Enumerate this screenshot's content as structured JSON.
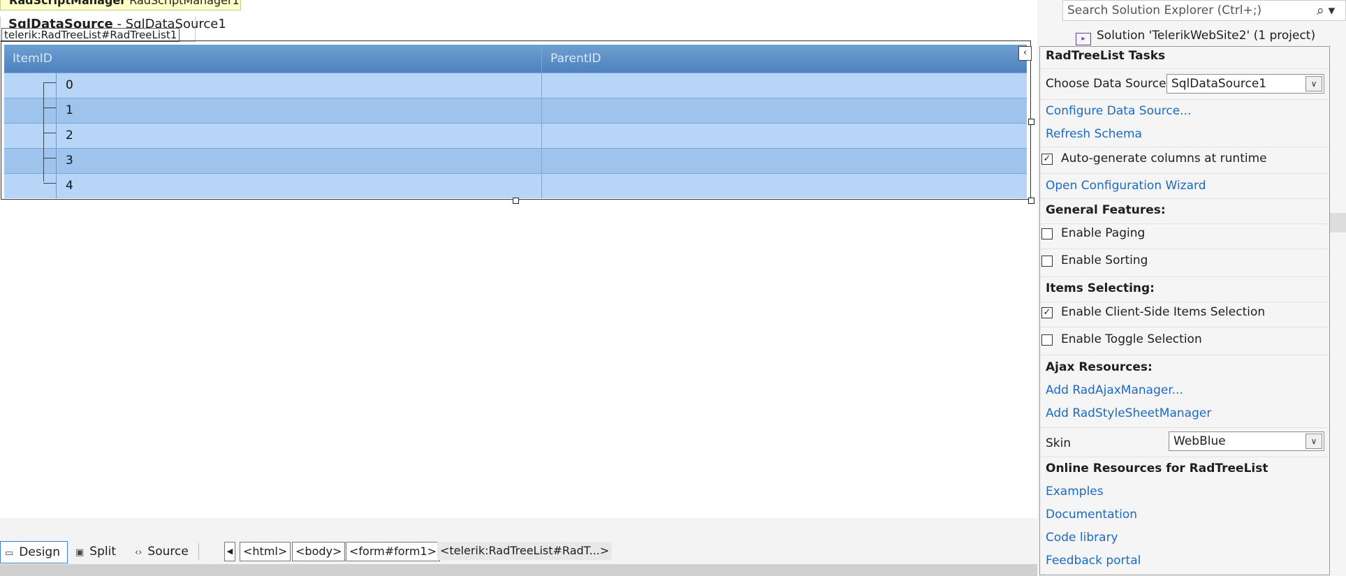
{
  "designer": {
    "script_manager": {
      "type": "RadScriptManager",
      "id": "RadScriptManager1"
    },
    "sql_datasource": {
      "type": "SqlDataSource",
      "sep": " - ",
      "id": "SqlDataSource1"
    },
    "tag_label": "telerik:RadTreeList#RadTreeList1",
    "treelist": {
      "columns": [
        "ItemID",
        "ParentID"
      ],
      "rows": [
        "0",
        "1",
        "2",
        "3",
        "4"
      ]
    },
    "smart_tag_glyph": "‹"
  },
  "bottom": {
    "tabs": [
      {
        "label": "Design",
        "icon": "design-view-icon"
      },
      {
        "label": "Split",
        "icon": "split-view-icon"
      },
      {
        "label": "Source",
        "icon": "source-view-icon"
      }
    ],
    "breadcrumbs": [
      "<html>",
      "<body>",
      "<form#form1>",
      "<telerik:RadTreeList#RadT...>"
    ]
  },
  "solution_explorer": {
    "search_placeholder": "Search Solution Explorer (Ctrl+;)",
    "solution_label": "Solution 'TelerikWebSite2' (1 project)"
  },
  "tasks": {
    "title": "RadTreeList Tasks",
    "choose_data_source_label": "Choose Data Source:",
    "data_source_value": "SqlDataSource1",
    "configure_data_source": "Configure Data Source...",
    "refresh_schema": "Refresh Schema",
    "auto_generate": {
      "label": "Auto-generate columns at runtime",
      "checked": true
    },
    "open_wizard": "Open Configuration Wizard",
    "general_features": "General Features:",
    "enable_paging": {
      "label": "Enable Paging",
      "checked": false
    },
    "enable_sorting": {
      "label": "Enable Sorting",
      "checked": false
    },
    "items_selecting": "Items Selecting:",
    "client_selection": {
      "label": "Enable Client-Side Items Selection",
      "checked": true
    },
    "toggle_selection": {
      "label": "Enable Toggle Selection",
      "checked": false
    },
    "ajax_resources": "Ajax Resources:",
    "add_ajax_manager": "Add RadAjaxManager...",
    "add_stylesheet_manager": "Add RadStyleSheetManager",
    "skin_label": "Skin",
    "skin_value": "WebBlue",
    "online_resources": "Online Resources for RadTreeList",
    "examples": "Examples",
    "documentation": "Documentation",
    "code_library": "Code library",
    "feedback_portal": "Feedback portal"
  },
  "glyphs": {
    "check": "✓",
    "dropdown": "∨",
    "search": "⌕"
  },
  "colors": {
    "accent": "#1b6ac2",
    "header": "#5b8fc7",
    "row_light": "#b7d6f7",
    "row_dark": "#9ec3ec"
  }
}
